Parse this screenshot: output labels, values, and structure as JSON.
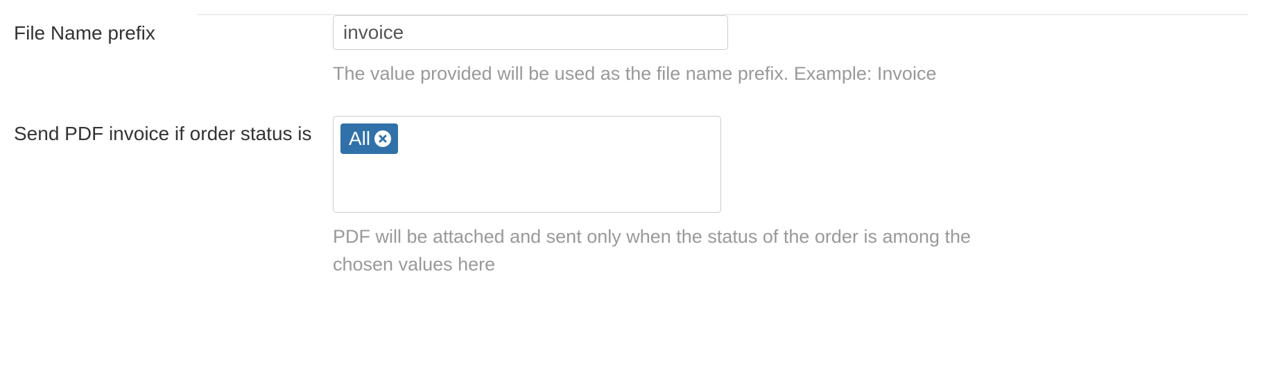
{
  "fields": {
    "fileNamePrefix": {
      "label": "File Name prefix",
      "value": "invoice",
      "help": "The value provided will be used as the file name prefix. Example: Invoice"
    },
    "orderStatus": {
      "label": "Send PDF invoice if order status is",
      "tags": [
        {
          "label": "All"
        }
      ],
      "help": "PDF will be attached and sent only when the status of the order is among the chosen values here"
    }
  }
}
